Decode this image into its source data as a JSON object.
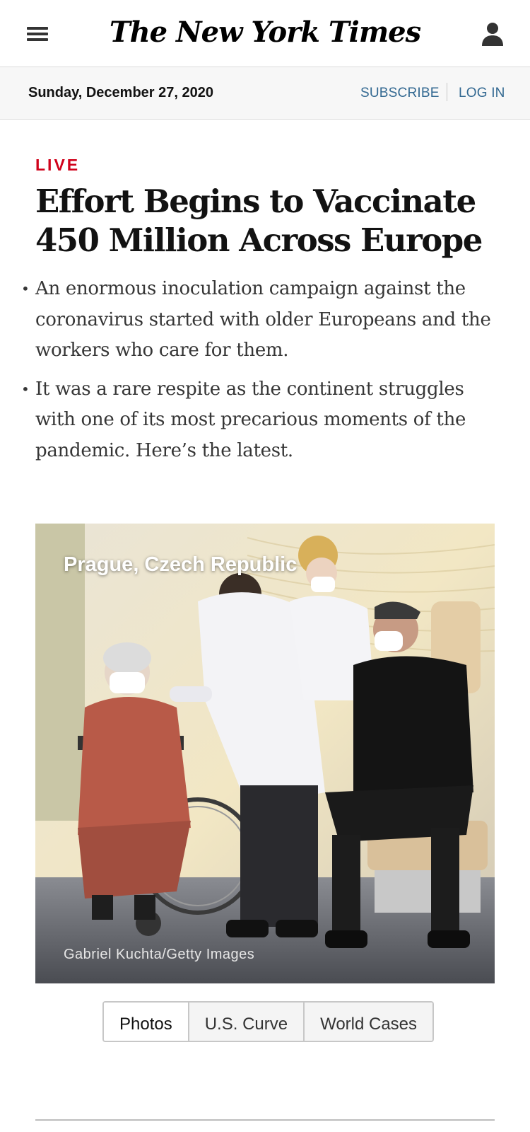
{
  "header": {
    "logo": "The New York Times",
    "menu_icon": "hamburger-menu-icon",
    "account_icon": "user-icon"
  },
  "datebar": {
    "date": "Sunday, December 27, 2020",
    "subscribe": "SUBSCRIBE",
    "login": "LOG IN"
  },
  "article": {
    "label": "LIVE",
    "headline": "Effort Begins to Vaccinate 450 Million Across Europe",
    "summary": [
      "An enormous inoculation campaign against the coronavirus started with older Europeans and the workers who care for them.",
      "It was a rare respite as the continent struggles with one of its most precarious moments of the pandemic. Here’s the latest."
    ],
    "bullet": "•"
  },
  "photo": {
    "location": "Prague, Czech Republic",
    "credit": "Gabriel Kuchta/Getty Images"
  },
  "tabs": [
    "Photos",
    "U.S. Curve",
    "World Cases"
  ],
  "colors": {
    "live_red": "#d0021b",
    "link_blue": "#326891",
    "datebar_bg": "#f7f7f7"
  }
}
